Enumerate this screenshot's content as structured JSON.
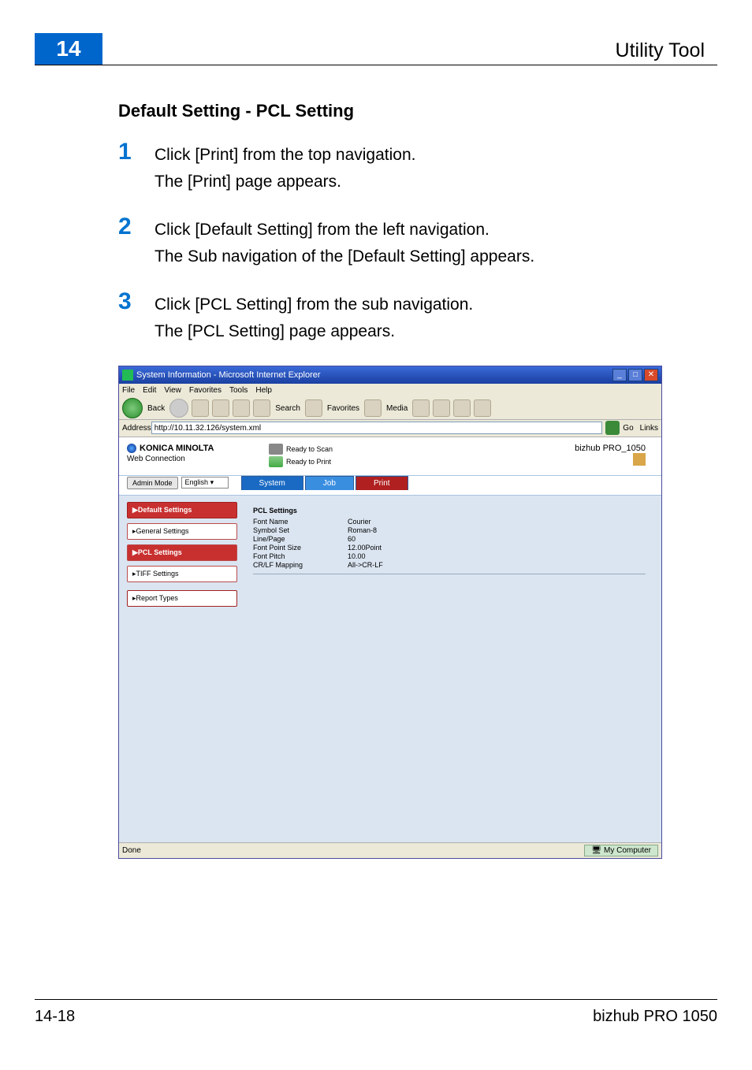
{
  "page": {
    "number": "14",
    "section": "Utility Tool",
    "footer_page": "14-18",
    "footer_model": "bizhub PRO 1050"
  },
  "heading": "Default Setting - PCL Setting",
  "steps": [
    {
      "num": "1",
      "line1": "Click [Print] from the top navigation.",
      "line2": "The [Print] page appears."
    },
    {
      "num": "2",
      "line1": "Click [Default Setting] from the left navigation.",
      "line2": "The Sub navigation of the [Default Setting] appears."
    },
    {
      "num": "3",
      "line1": "Click [PCL Setting] from the sub navigation.",
      "line2": "The [PCL Setting] page appears."
    }
  ],
  "browser": {
    "title": "System Information - Microsoft Internet Explorer",
    "menubar": [
      "File",
      "Edit",
      "View",
      "Favorites",
      "Tools",
      "Help"
    ],
    "toolbar": {
      "back": "Back",
      "search": "Search",
      "favorites": "Favorites",
      "media": "Media"
    },
    "address_label": "Address",
    "address_value": "http://10.11.32.126/system.xml",
    "go": "Go",
    "links": "Links",
    "status_done": "Done",
    "status_zone": "My Computer"
  },
  "webapp": {
    "brand": "KONICA MINOLTA",
    "brand_sub": "Web Connection",
    "printer_status": [
      {
        "label": "Ready to Scan"
      },
      {
        "label": "Ready to Print"
      }
    ],
    "model": "bizhub PRO_1050",
    "mode_btn": "Admin Mode",
    "mode_lang": "English",
    "tabs": {
      "system": "System",
      "job": "Job",
      "print": "Print"
    },
    "sidenav": {
      "default_settings": "▶Default Settings",
      "general": "▸General Settings",
      "pcl": "▶PCL Settings",
      "tiff": "▸TIFF Settings",
      "report": "▸Report Types"
    },
    "data": {
      "heading": "PCL Settings",
      "rows": [
        {
          "k": "Font Name",
          "v": "Courier"
        },
        {
          "k": "Symbol Set",
          "v": "Roman-8"
        },
        {
          "k": "Line/Page",
          "v": "60"
        },
        {
          "k": "Font Point Size",
          "v": "12.00Point"
        },
        {
          "k": "Font Pitch",
          "v": "10.00"
        },
        {
          "k": "CR/LF Mapping",
          "v": "All->CR-LF"
        }
      ]
    }
  }
}
